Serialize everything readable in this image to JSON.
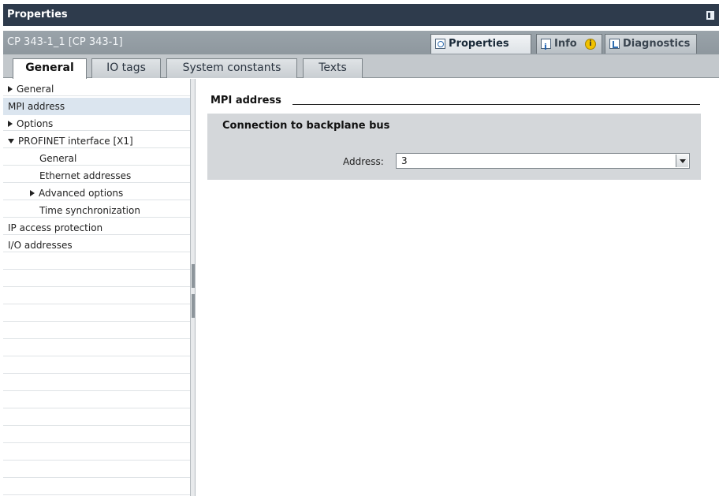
{
  "window": {
    "title": "Properties"
  },
  "object_bar": {
    "title": "CP 343-1_1 [CP 343-1]"
  },
  "right_tabs": [
    {
      "label": "Properties",
      "icon": "magnifier-icon",
      "active": true
    },
    {
      "label": "Info",
      "icon": "info-list-icon"
    },
    {
      "label": "Diagnostics",
      "icon": "diagnostics-icon"
    }
  ],
  "info_badge": "i",
  "tabs": [
    {
      "label": "General",
      "active": true
    },
    {
      "label": "IO tags"
    },
    {
      "label": "System constants"
    },
    {
      "label": "Texts"
    }
  ],
  "nav": {
    "items": [
      {
        "label": "General",
        "expander": "collapsed"
      },
      {
        "label": "MPI address",
        "selected": true
      },
      {
        "label": "Options",
        "expander": "collapsed"
      },
      {
        "label": "PROFINET interface [X1]",
        "expander": "expanded"
      },
      {
        "label": "General"
      },
      {
        "label": "Ethernet addresses"
      },
      {
        "label": "Advanced options",
        "expander": "collapsed"
      },
      {
        "label": "Time synchronization"
      },
      {
        "label": "IP access protection"
      },
      {
        "label": "I/O addresses"
      }
    ]
  },
  "content": {
    "section_title": "MPI address",
    "group_title": "Connection to backplane bus",
    "address_label": "Address:",
    "address_value": "3"
  },
  "colors": {
    "titlebar": "#2e3b4c",
    "object_bar": "#9aa3aa",
    "selected_row": "#dbe5ef",
    "group_background": "#d4d7da"
  }
}
